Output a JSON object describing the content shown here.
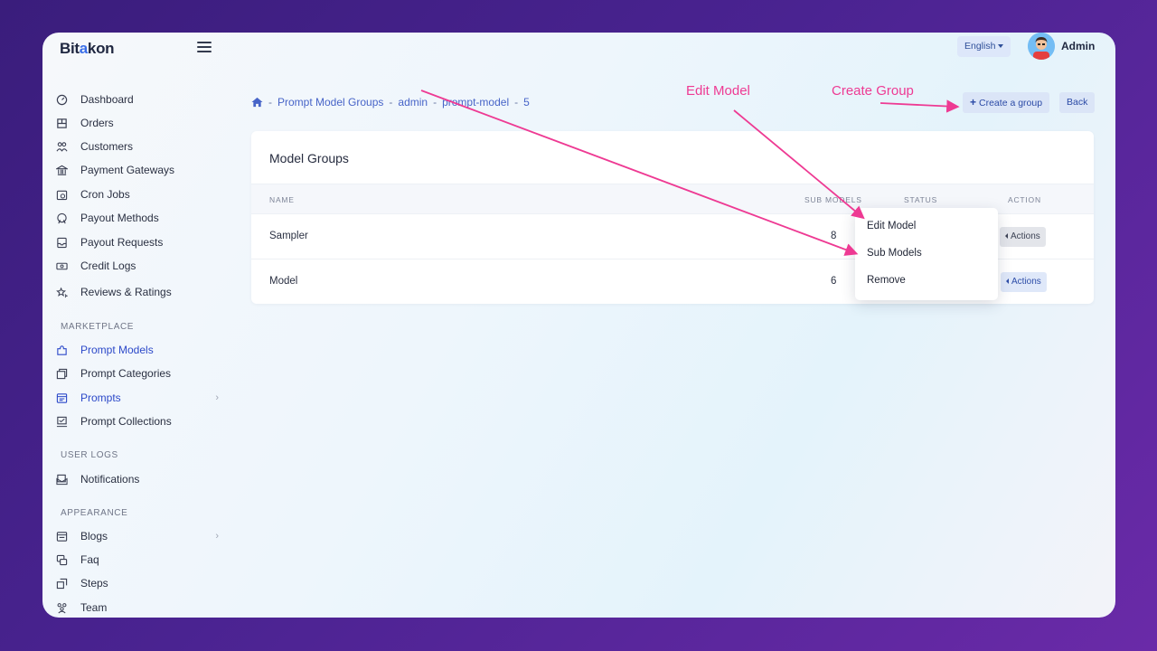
{
  "brand": {
    "logo_prefix": "Bit",
    "logo_accent": "a",
    "logo_suffix": "kon"
  },
  "topbar": {
    "language": "English",
    "user_name": "Admin"
  },
  "sidebar": {
    "items_main": [
      {
        "label": "Dashboard",
        "icon": "speedometer-icon"
      },
      {
        "label": "Orders",
        "icon": "orders-icon"
      },
      {
        "label": "Customers",
        "icon": "users-icon"
      },
      {
        "label": "Payment Gateways",
        "icon": "bank-icon"
      },
      {
        "label": "Cron Jobs",
        "icon": "calendar-clock-icon"
      },
      {
        "label": "Payout Methods",
        "icon": "coin-icon"
      },
      {
        "label": "Payout Requests",
        "icon": "inbox-icon"
      },
      {
        "label": "Credit Logs",
        "icon": "money-icon"
      },
      {
        "label": "Reviews & Ratings",
        "icon": "stars-icon"
      }
    ],
    "section_marketplace": "MARKETPLACE",
    "items_marketplace": [
      {
        "label": "Prompt Models",
        "icon": "puzzle-icon"
      },
      {
        "label": "Prompt Categories",
        "icon": "folders-icon"
      },
      {
        "label": "Prompts",
        "icon": "browser-icon"
      },
      {
        "label": "Prompt Collections",
        "icon": "collection-icon"
      }
    ],
    "section_user_logs": "USER LOGS",
    "items_user_logs": [
      {
        "label": "Notifications",
        "icon": "bell-mail-icon"
      }
    ],
    "section_appearance": "APPEARANCE",
    "items_appearance": [
      {
        "label": "Blogs",
        "icon": "blog-icon"
      },
      {
        "label": "Faq",
        "icon": "faq-icon"
      },
      {
        "label": "Steps",
        "icon": "steps-icon"
      },
      {
        "label": "Team",
        "icon": "team-icon"
      }
    ]
  },
  "breadcrumb": {
    "sep": "-",
    "items": [
      "Prompt Model Groups",
      "admin",
      "prompt-model",
      "5"
    ]
  },
  "toolbar": {
    "create_label": "Create a group",
    "back_label": "Back"
  },
  "card": {
    "title": "Model Groups",
    "columns": [
      "NAME",
      "SUB MODELS",
      "STATUS",
      "ACTION"
    ],
    "rows": [
      {
        "name": "Sampler",
        "sub_models": "8",
        "action": "Actions"
      },
      {
        "name": "Model",
        "sub_models": "6",
        "action": "Actions"
      }
    ]
  },
  "dropdown": {
    "items": [
      "Edit Model",
      "Sub Models",
      "Remove"
    ]
  },
  "annotations": {
    "edit_model": "Edit Model",
    "create_group": "Create Group"
  },
  "colors": {
    "accent": "#2c49c9",
    "annotation": "#ee3a93",
    "logo_accent": "#3a6ee8"
  }
}
